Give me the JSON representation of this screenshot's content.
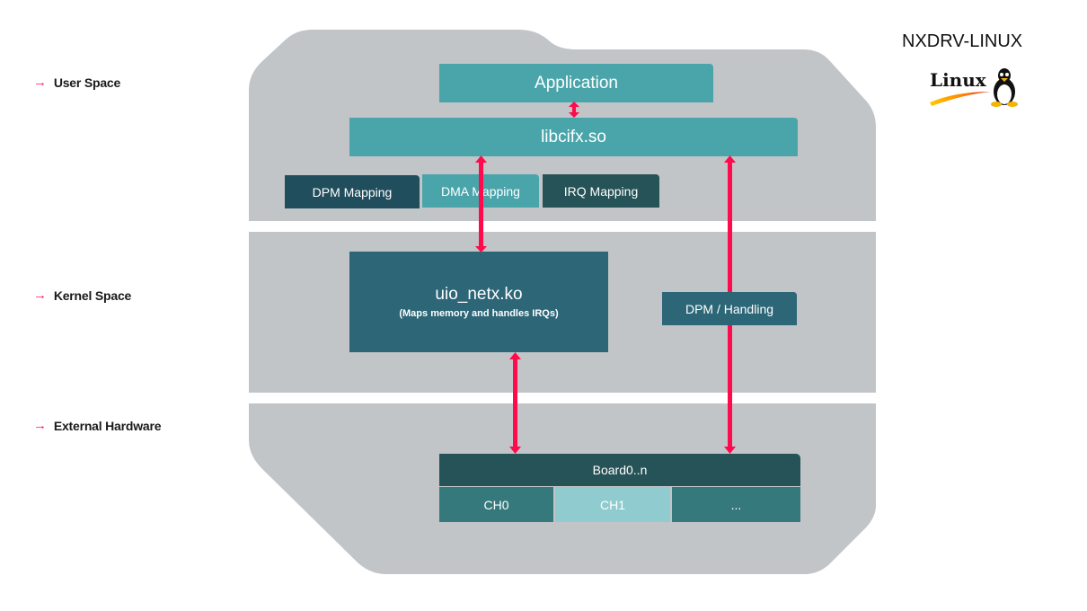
{
  "title": "NXDRV-LINUX",
  "logo": {
    "text": "Linux",
    "icon": "tux-penguin-icon"
  },
  "layers": [
    {
      "label": "User Space",
      "icon": "arrow-right-icon"
    },
    {
      "label": "Kernel Space",
      "icon": "arrow-right-icon"
    },
    {
      "label": "External Hardware",
      "icon": "arrow-right-icon"
    }
  ],
  "user_space": {
    "application": "Application",
    "library": "libcifx.so",
    "mappings": [
      "DPM Mapping",
      "DMA Mapping",
      "IRQ Mapping"
    ]
  },
  "kernel_space": {
    "module_name": "uio_netx.ko",
    "module_desc": "(Maps memory and handles IRQs)",
    "dpm_handling": "DPM / Handling"
  },
  "hardware": {
    "board": "Board0..n",
    "channels": [
      "CH0",
      "CH1",
      "..."
    ]
  },
  "colors": {
    "background_shape": "#c2c5c8",
    "teal_light": "#4aa5ab",
    "teal_dark": "#2c6677",
    "teal_darker": "#214e5c",
    "board_header": "#265357",
    "channel_dark": "#36797c",
    "channel_light": "#8fcbcf",
    "arrow": "#ff0a4d"
  }
}
